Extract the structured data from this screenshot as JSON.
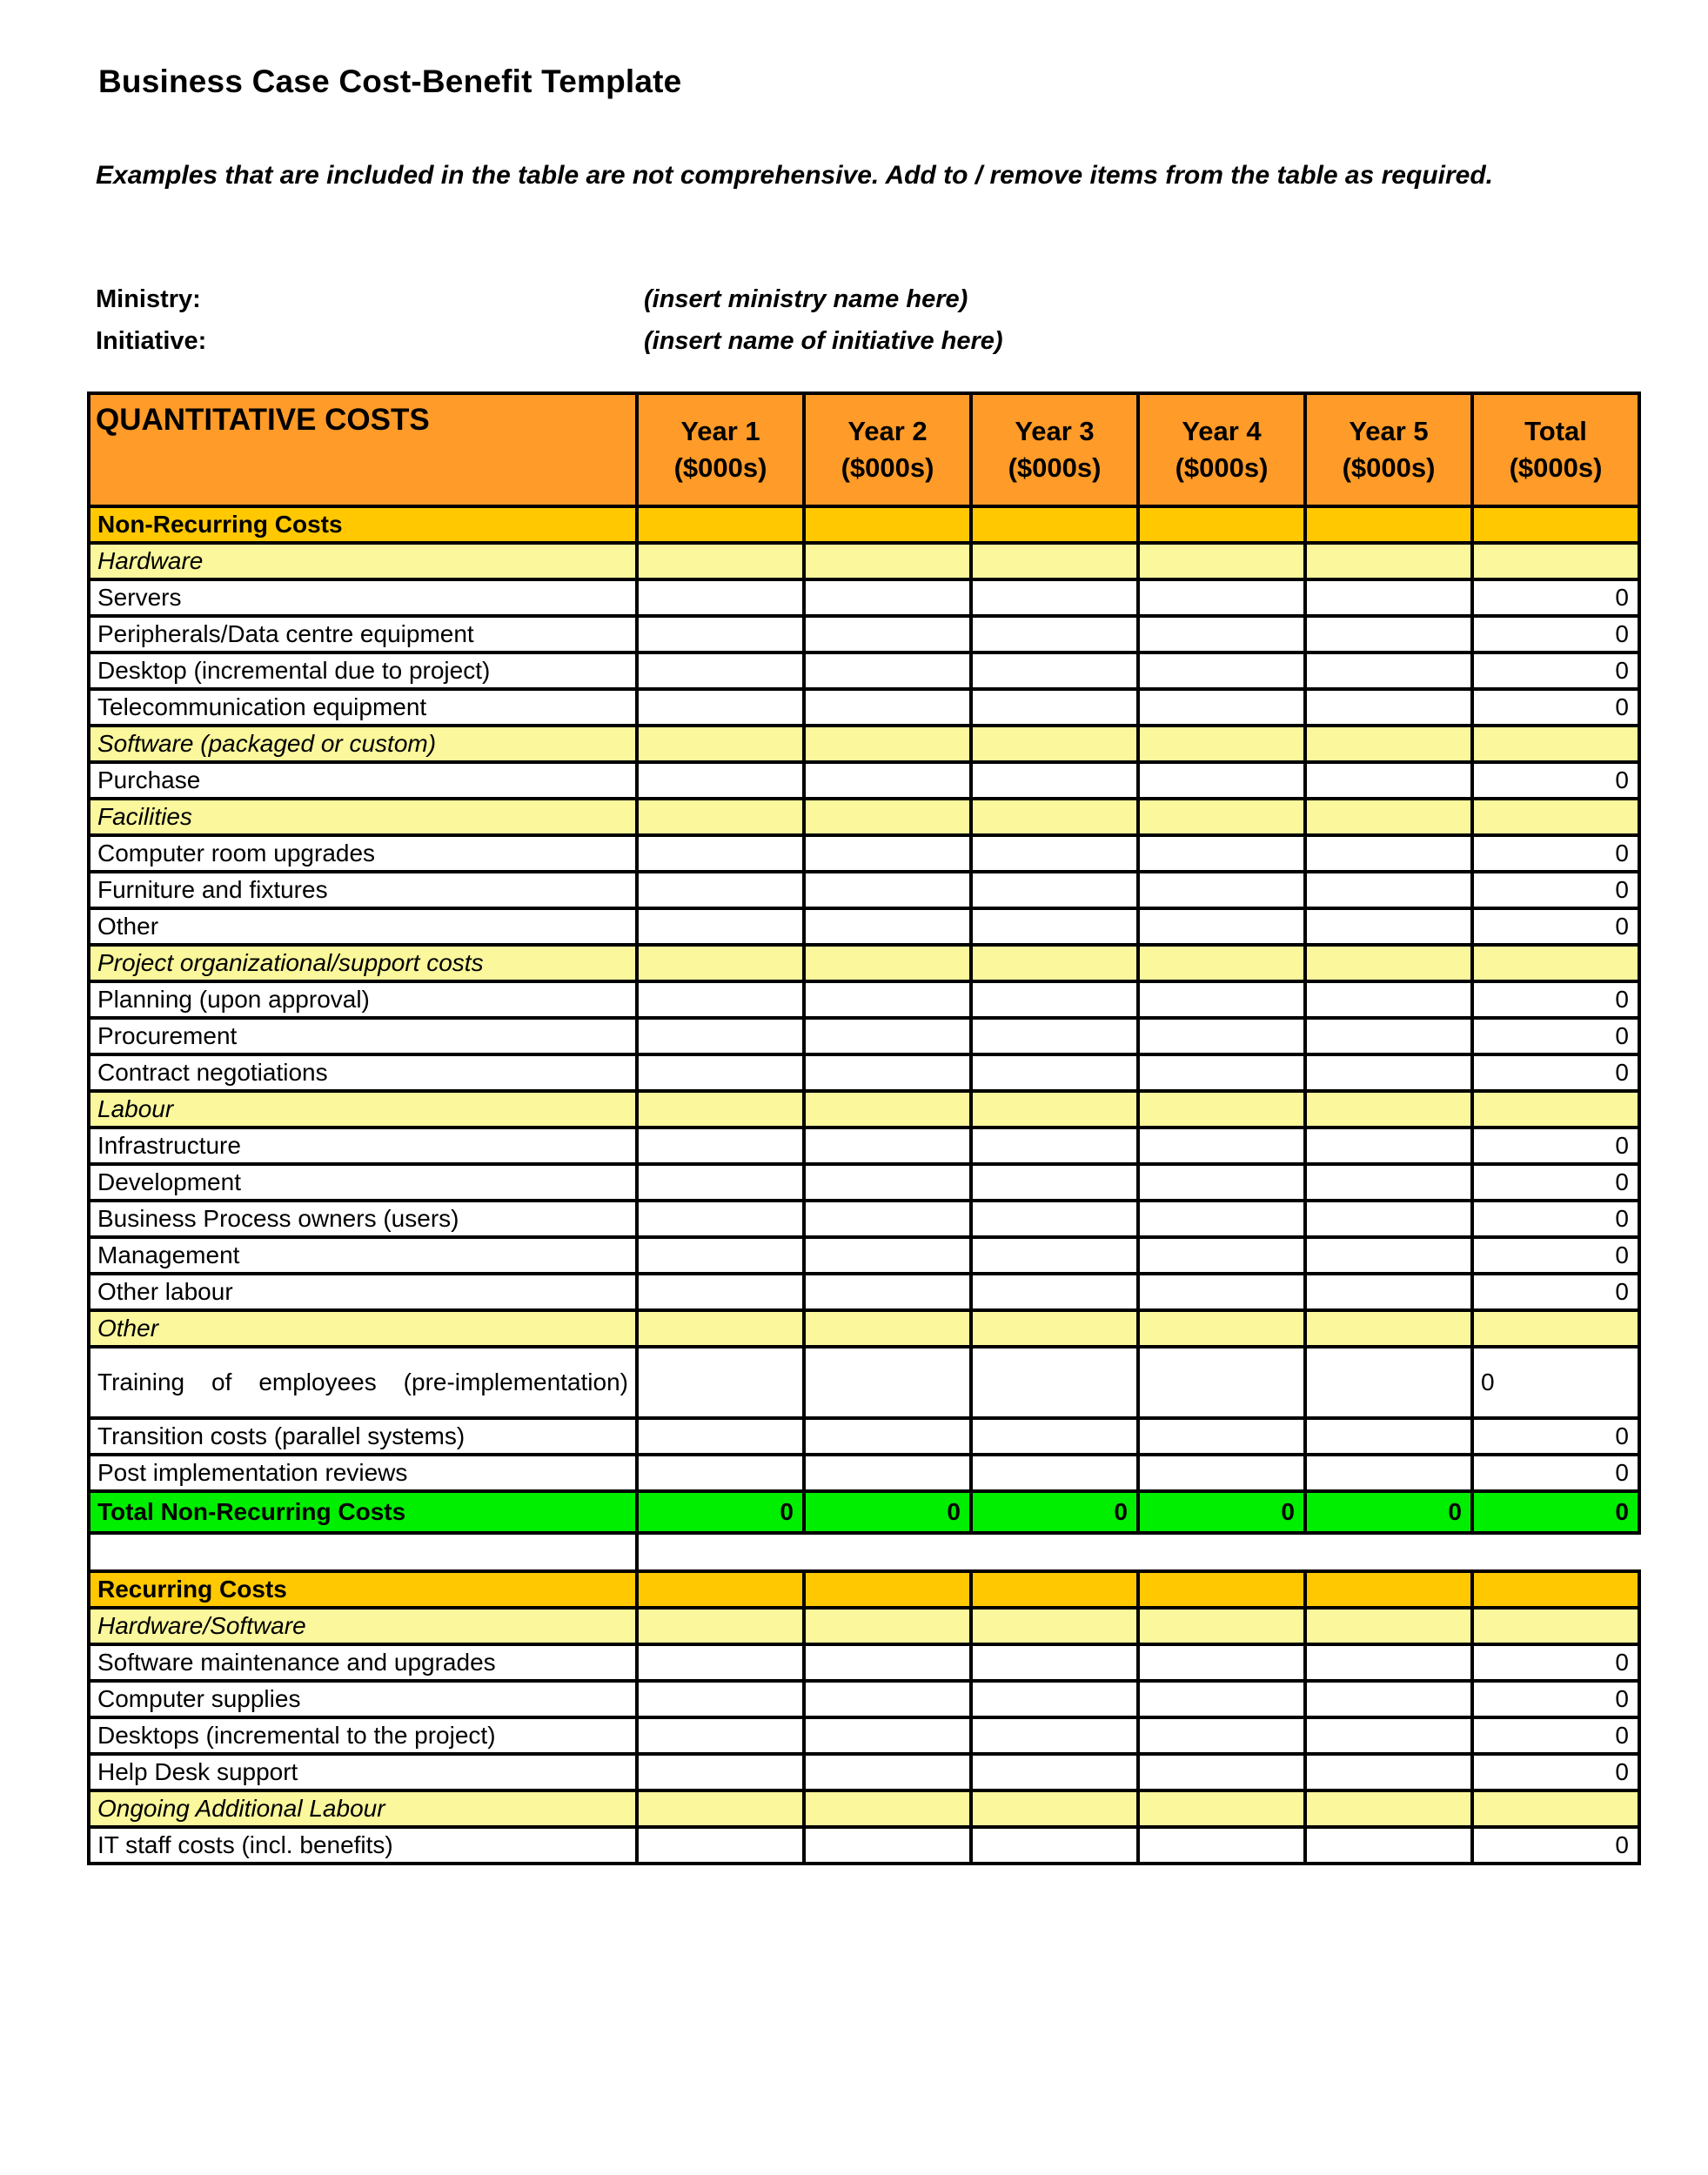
{
  "document": {
    "title": "Business Case Cost-Benefit Template",
    "intro": "Examples that are included in the table are not comprehensive.  Add to / remove items from the table as required.",
    "meta": [
      {
        "label": "Ministry:",
        "value": "(insert ministry name here)"
      },
      {
        "label": "Initiative:",
        "value": "(insert name of initiative here)"
      }
    ]
  },
  "colors": {
    "header_orange": "#FF9B28",
    "section_gold": "#FFC800",
    "subsection_yellow": "#FAF79C",
    "total_green": "#00EE00",
    "grid_black": "#000000"
  },
  "table": {
    "header": {
      "label": "QUANTITATIVE COSTS",
      "columns": [
        {
          "line1": "Year 1",
          "line2": "($000s)"
        },
        {
          "line1": "Year 2",
          "line2": "($000s)"
        },
        {
          "line1": "Year 3",
          "line2": "($000s)"
        },
        {
          "line1": "Year 4",
          "line2": "($000s)"
        },
        {
          "line1": "Year 5",
          "line2": "($000s)"
        },
        {
          "line1": "Total",
          "line2": "($000s)"
        }
      ]
    },
    "rows": [
      {
        "type": "section",
        "label": "Non-Recurring Costs",
        "values": [
          "",
          "",
          "",
          "",
          "",
          ""
        ]
      },
      {
        "type": "sub",
        "label": "Hardware",
        "values": [
          "",
          "",
          "",
          "",
          "",
          ""
        ]
      },
      {
        "type": "item",
        "label": "Servers",
        "values": [
          "",
          "",
          "",
          "",
          "",
          "0"
        ]
      },
      {
        "type": "item",
        "label": "Peripherals/Data centre equipment",
        "values": [
          "",
          "",
          "",
          "",
          "",
          "0"
        ]
      },
      {
        "type": "item",
        "label": "Desktop (incremental due to project)",
        "values": [
          "",
          "",
          "",
          "",
          "",
          "0"
        ]
      },
      {
        "type": "item",
        "label": "Telecommunication equipment",
        "values": [
          "",
          "",
          "",
          "",
          "",
          "0"
        ]
      },
      {
        "type": "sub",
        "label": "Software (packaged or custom)",
        "values": [
          "",
          "",
          "",
          "",
          "",
          ""
        ]
      },
      {
        "type": "item",
        "label": "Purchase",
        "values": [
          "",
          "",
          "",
          "",
          "",
          "0"
        ]
      },
      {
        "type": "sub",
        "label": "Facilities",
        "values": [
          "",
          "",
          "",
          "",
          "",
          ""
        ]
      },
      {
        "type": "item",
        "label": "Computer room upgrades",
        "values": [
          "",
          "",
          "",
          "",
          "",
          "0"
        ]
      },
      {
        "type": "item",
        "label": "Furniture and fixtures",
        "values": [
          "",
          "",
          "",
          "",
          "",
          "0"
        ]
      },
      {
        "type": "item",
        "label": "Other",
        "values": [
          "",
          "",
          "",
          "",
          "",
          "0"
        ]
      },
      {
        "type": "sub",
        "label": "Project organizational/support costs",
        "values": [
          "",
          "",
          "",
          "",
          "",
          ""
        ]
      },
      {
        "type": "item",
        "label": "Planning (upon approval)",
        "values": [
          "",
          "",
          "",
          "",
          "",
          "0"
        ]
      },
      {
        "type": "item",
        "label": "Procurement",
        "values": [
          "",
          "",
          "",
          "",
          "",
          "0"
        ]
      },
      {
        "type": "item",
        "label": "Contract negotiations",
        "values": [
          "",
          "",
          "",
          "",
          "",
          "0"
        ]
      },
      {
        "type": "sub",
        "label": "Labour",
        "values": [
          "",
          "",
          "",
          "",
          "",
          ""
        ]
      },
      {
        "type": "item",
        "label": "Infrastructure",
        "values": [
          "",
          "",
          "",
          "",
          "",
          "0"
        ]
      },
      {
        "type": "item",
        "label": "Development",
        "values": [
          "",
          "",
          "",
          "",
          "",
          "0"
        ]
      },
      {
        "type": "item",
        "label": "Business Process owners (users)",
        "values": [
          "",
          "",
          "",
          "",
          "",
          "0"
        ]
      },
      {
        "type": "item",
        "label": "Management",
        "values": [
          "",
          "",
          "",
          "",
          "",
          "0"
        ]
      },
      {
        "type": "item",
        "label": "Other labour",
        "values": [
          "",
          "",
          "",
          "",
          "",
          "0"
        ]
      },
      {
        "type": "sub",
        "label": "Other",
        "values": [
          "",
          "",
          "",
          "",
          "",
          ""
        ]
      },
      {
        "type": "item-tall",
        "label": "Training of employees (pre-implementation)",
        "values": [
          "",
          "",
          "",
          "",
          "",
          "0"
        ]
      },
      {
        "type": "item",
        "label": "Transition costs (parallel systems)",
        "values": [
          "",
          "",
          "",
          "",
          "",
          "0"
        ]
      },
      {
        "type": "item",
        "label": "Post implementation reviews",
        "values": [
          "",
          "",
          "",
          "",
          "",
          "0"
        ]
      },
      {
        "type": "total",
        "label": "Total Non-Recurring Costs",
        "values": [
          "0",
          "0",
          "0",
          "0",
          "0",
          "0"
        ]
      },
      {
        "type": "spacer",
        "label": "",
        "values": [
          "",
          "",
          "",
          "",
          "",
          ""
        ]
      },
      {
        "type": "section",
        "label": "Recurring Costs",
        "values": [
          "",
          "",
          "",
          "",
          "",
          ""
        ]
      },
      {
        "type": "sub",
        "label": "Hardware/Software",
        "values": [
          "",
          "",
          "",
          "",
          "",
          ""
        ]
      },
      {
        "type": "item",
        "label": "Software maintenance and upgrades",
        "values": [
          "",
          "",
          "",
          "",
          "",
          "0"
        ]
      },
      {
        "type": "item",
        "label": "Computer supplies",
        "values": [
          "",
          "",
          "",
          "",
          "",
          "0"
        ]
      },
      {
        "type": "item",
        "label": "Desktops (incremental to the project)",
        "values": [
          "",
          "",
          "",
          "",
          "",
          "0"
        ]
      },
      {
        "type": "item",
        "label": "Help Desk support",
        "values": [
          "",
          "",
          "",
          "",
          "",
          "0"
        ]
      },
      {
        "type": "sub",
        "label": "Ongoing Additional Labour",
        "values": [
          "",
          "",
          "",
          "",
          "",
          ""
        ]
      },
      {
        "type": "item",
        "label": "IT staff costs (incl. benefits)",
        "values": [
          "",
          "",
          "",
          "",
          "",
          "0"
        ]
      }
    ]
  }
}
